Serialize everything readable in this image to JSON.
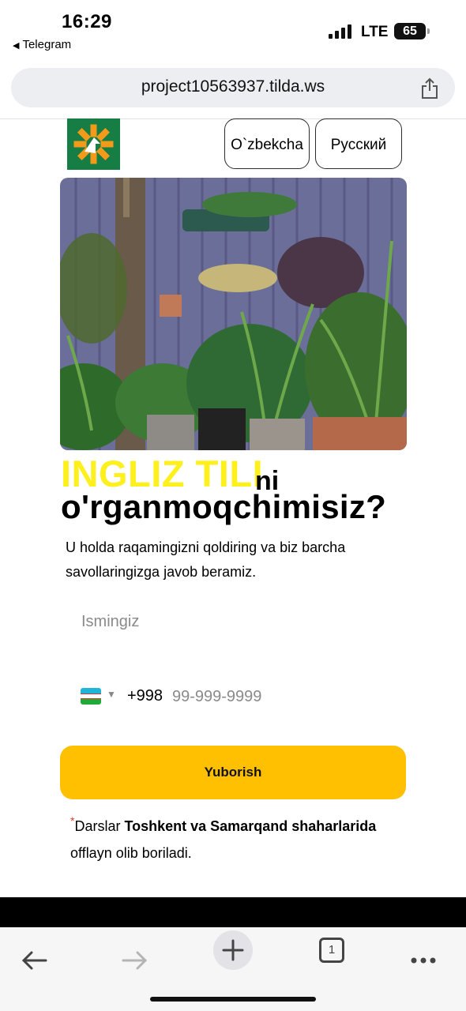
{
  "status_bar": {
    "time": "16:29",
    "back_app": "Telegram",
    "network": "LTE",
    "battery": "65"
  },
  "browser": {
    "url": "project10563937.tilda.ws",
    "share_icon": "share-icon",
    "tab_count": "1"
  },
  "header": {
    "logo_icon": "orange-star-logo",
    "lang_uz": "O`zbekcha",
    "lang_ru": "Русский"
  },
  "hero": {
    "description_icon": "garden-plants-photo"
  },
  "headline": {
    "highlight": "INGLIZ TILI",
    "suffix": "ni",
    "line2": "o'rganmoqchimisiz?"
  },
  "subtitle": "U holda raqamingizni qoldiring va biz barcha savollaringizga javob beramiz.",
  "form": {
    "name_placeholder": "Ismingiz",
    "phone_code": "+998",
    "phone_placeholder": "99-999-9999",
    "submit_label": "Yuborish"
  },
  "note": {
    "asterisk": "*",
    "text_start": "Darslar ",
    "text_bold": "Toshkent va Samarqand shaharlarida",
    "text_end": " offlayn olib boriladi."
  },
  "colors": {
    "highlight_yellow": "#fdf01c",
    "button_yellow": "#fec000",
    "logo_green": "#167d44"
  }
}
